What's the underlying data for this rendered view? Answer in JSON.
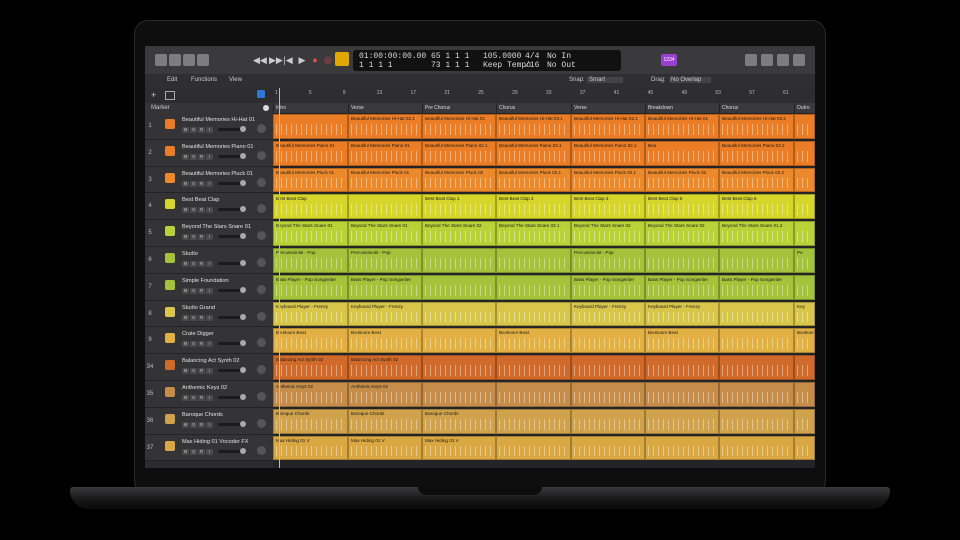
{
  "lcd": {
    "time": "01:00:00:00.00",
    "bars": "1   1   1      1",
    "position": "65  1  1    1",
    "position2": "73  1  1    1",
    "tempo": "105.0000",
    "tempo_mode": "Keep Tempo",
    "signature": "4/4",
    "division": "/16",
    "in": "No In",
    "out": "No Out"
  },
  "toolbar": {
    "edit": "Edit",
    "functions": "Functions",
    "view": "View",
    "snap_label": "Snap:",
    "snap_value": "Smart",
    "drag_label": "Drag:",
    "drag_value": "No Overlap"
  },
  "badge": "1234",
  "marker_header": "Marker",
  "ruler": [
    "1",
    "5",
    "9",
    "13",
    "17",
    "21",
    "25",
    "29",
    "33",
    "37",
    "41",
    "45",
    "49",
    "53",
    "57",
    "61"
  ],
  "sections": [
    "Intro",
    "Verse",
    "Pre Chorus",
    "Chorus",
    "Verse",
    "Breakdown",
    "Chorus",
    "Outro"
  ],
  "tracks": [
    {
      "num": "1",
      "name": "Beautiful Memories Hi-Hat 01",
      "color": "#ea7d25",
      "regions": [
        "",
        "Beautiful Memories Hi-Hat 02.1",
        "Beautiful Memories Hi-Hat 01",
        "Beautiful Memories Hi-Hat 03.1",
        "Beautiful Memories Hi-Hat 02.1",
        "Beautiful Memories Hi-Hat 01",
        "Beautiful Memories Hi-Hat 03.2",
        ""
      ]
    },
    {
      "num": "2",
      "name": "Beautiful Memories Piano 01",
      "color": "#ea7d25",
      "regions": [
        "Beautiful Memories Piano 01",
        "Beautiful Memories Piano 01",
        "Beautiful Memories Piano 02.1",
        "Beautiful Memories Piano 03.1",
        "Beautiful Memories Piano 02.1",
        "Bea",
        "Beautiful Memories Piano 03.2",
        ""
      ]
    },
    {
      "num": "3",
      "name": "Beautiful Memories Pluck 01",
      "color": "#ec8a2b",
      "regions": [
        "Beautiful Memories Pluck 01",
        "Beautiful Memories Pluck 01",
        "Beautiful Memories Pluck 02",
        "Beautiful Memories Pluck 02.1",
        "Beautiful Memories Pluck 02.1",
        "Beautiful Memories Pluck 02",
        "Beautiful Memories Pluck 03.2",
        ""
      ]
    },
    {
      "num": "4",
      "name": "Best Beat Clap",
      "color": "#d6d62a",
      "regions": [
        "Best Beat Clap",
        "",
        "Best Beat Clap 1",
        "Best Beat Clap 3",
        "Best Beat Clap 3",
        "Best Beat Clap 6",
        "Best Beat Clap 6",
        ""
      ]
    },
    {
      "num": "5",
      "name": "Beyond The Stars Snare 01",
      "color": "#b9d238",
      "regions": [
        "Beyond The Stars Snare 01",
        "Beyond The Stars Snare 01",
        "Beyond The Stars Snare 02",
        "Beyond The Stars Snare 03.1",
        "Beyond The Stars Snare 02",
        "Beyond The Stars Snare 02",
        "Beyond The Stars Snare 01.2",
        ""
      ]
    },
    {
      "num": "6",
      "name": "Studio",
      "color": "#a4c23a",
      "regions": [
        "Percussionist - Pop",
        "Percussionist - Pop",
        "",
        "",
        "Percussionist - Pop",
        "",
        "",
        "Pe"
      ]
    },
    {
      "num": "7",
      "name": "Simple Foundation",
      "color": "#a4c23a",
      "regions": [
        "Bass Player - Pop Songwriter",
        "Bass Player - Pop Songwriter",
        "",
        "",
        "Bass Player - Pop Songwriter",
        "Bass Player - Pop Songwriter",
        "Bass Player - Pop Songwriter",
        ""
      ]
    },
    {
      "num": "8",
      "name": "Studio Grand",
      "color": "#d8c64a",
      "regions": [
        "Keyboard Player - Frenzy",
        "Keyboard Player - Frenzy",
        "",
        "",
        "Keyboard Player - Frenzy",
        "Keyboard Player - Frenzy",
        "",
        "Key"
      ]
    },
    {
      "num": "9",
      "name": "Crate Digger",
      "color": "#e2b043",
      "regions": [
        "Ba-Boom Beat",
        "Ba-Boom Beat",
        "",
        "Ba-Boom Beat",
        "",
        "Ba-Boom Beat",
        "",
        "Ba-Boom Beat"
      ]
    },
    {
      "num": "34",
      "name": "Balancing Act Synth 02",
      "color": "#cf6a2a",
      "regions": [
        "Balancing Act Synth 02",
        "Balancing Act Synth 02",
        "",
        "",
        "",
        "",
        "",
        ""
      ]
    },
    {
      "num": "35",
      "name": "Anthemic Keys 02",
      "color": "#c58c4a",
      "regions": [
        "Anthemic Keys 02",
        "Anthemic Keys 02",
        "",
        "",
        "",
        "",
        "",
        ""
      ]
    },
    {
      "num": "36",
      "name": "Baroque Chords",
      "color": "#cfa24b",
      "regions": [
        "Baroque Chords",
        "Baroque Chords",
        "Baroque Chords",
        "",
        "",
        "",
        "",
        ""
      ]
    },
    {
      "num": "37",
      "name": "Max Hiding 01 Vocoder FX",
      "color": "#d9a843",
      "regions": [
        "Max Hiding 01 V",
        "Max Hiding 01 V",
        "Max Hiding 01 V",
        "",
        "",
        "",
        "",
        ""
      ]
    }
  ]
}
